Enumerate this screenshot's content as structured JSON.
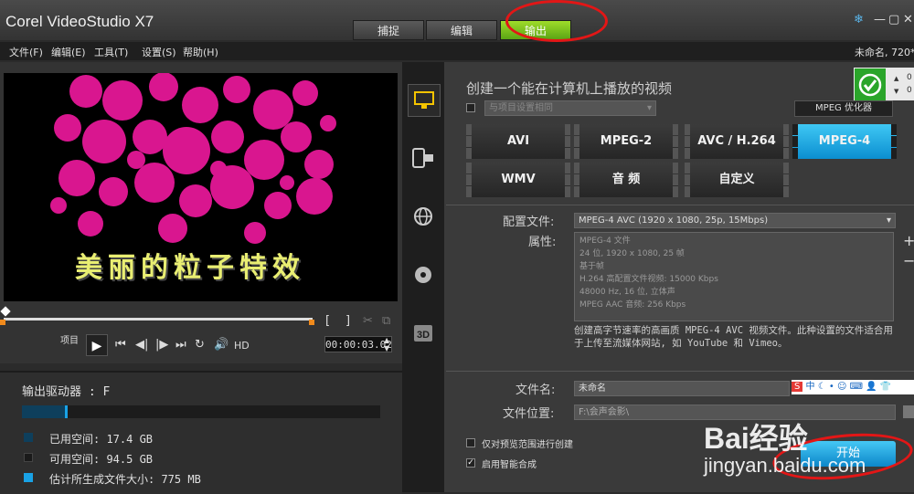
{
  "app": {
    "title": "Corel VideoStudio X7",
    "project_info": "未命名, 720*48"
  },
  "tabs": [
    {
      "label": "捕捉"
    },
    {
      "label": "编辑"
    },
    {
      "label": "输出"
    }
  ],
  "menu": [
    {
      "label": "文件(F)"
    },
    {
      "label": "编辑(E)"
    },
    {
      "label": "工具(T)"
    },
    {
      "label": "设置(S)"
    },
    {
      "label": "帮助(H)"
    }
  ],
  "preview": {
    "caption": "美丽的粒子特效",
    "project_label": "项目",
    "hd_label": "HD",
    "timecode": "00:00:03.02",
    "mark_in": "[",
    "mark_out": "]"
  },
  "output_info": {
    "drive_label": "输出驱动器 : F",
    "drive_usage_fraction": 0.12,
    "items": [
      {
        "label": "已用空间: 17.4 GB",
        "color": "#0e3f5c"
      },
      {
        "label": "可用空间: 94.5 GB",
        "color": "#1a1a1a"
      },
      {
        "label": "估计所生成文件大小: 775 MB",
        "color": "#19a2e6"
      }
    ]
  },
  "output_panel": {
    "heading": "创建一个能在计算机上播放的视频",
    "same_as_project": "与项目设置相同",
    "mpeg_optimizer": "MPEG 优化器",
    "formats_row1": [
      {
        "label": "AVI"
      },
      {
        "label": "MPEG-2"
      },
      {
        "label": "AVC / H.264"
      },
      {
        "label": "MPEG-4"
      }
    ],
    "formats_row2": [
      {
        "label": "WMV"
      },
      {
        "label": "音 频"
      },
      {
        "label": "自定义"
      }
    ],
    "selected_format": "MPEG-4",
    "profile_label": "配置文件:",
    "profile_value": "MPEG-4 AVC (1920 x 1080, 25p, 15Mbps)",
    "properties_label": "属性:",
    "properties": [
      "MPEG-4 文件",
      "24 位, 1920 x 1080, 25 帧",
      "基于帧",
      "H.264 高配置文件视频: 15000 Kbps",
      "48000 Hz, 16 位, 立体声",
      "MPEG AAC 音频: 256 Kbps"
    ],
    "description": "创建高字节速率的高画质 MPEG-4 AVC 视频文件。此种设置的文件适合用于上传至流媒体网站, 如 YouTube 和 Vimeo。",
    "filename_label": "文件名:",
    "filename_value": "未命名",
    "location_label": "文件位置:",
    "location_value": "F:\\会声会影\\",
    "preview_range_only": "仅对预览范围进行创建",
    "smart_render": "启用智能合成",
    "start_button": "开始",
    "side_numbers": [
      "0",
      "0"
    ]
  },
  "watermark": {
    "logo": "Bai经验",
    "url": "jingyan.baidu.com"
  },
  "colors": {
    "accent_blue": "#0b8ed0",
    "tab_green": "#5aa514",
    "annotation_red": "#e31616"
  }
}
